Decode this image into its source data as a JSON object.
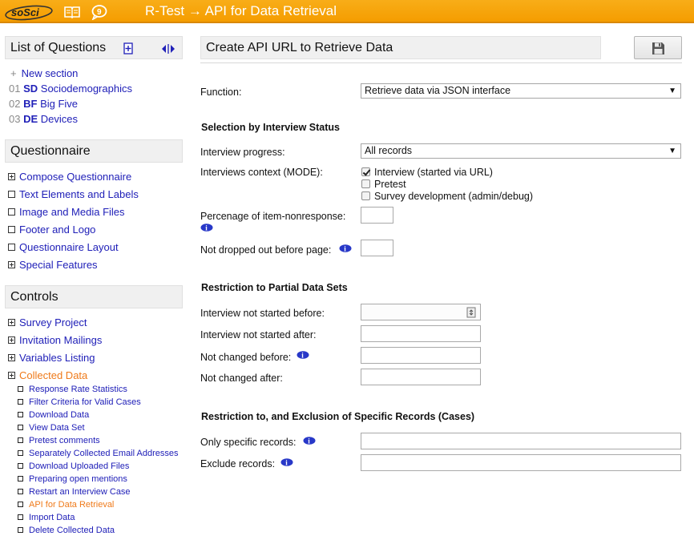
{
  "header": {
    "logo_text": "soSci",
    "title": "R-Test → API for Data Retrieval",
    "colors": {
      "bar": "#f59d00",
      "text": "#ffffff"
    },
    "icons": [
      "book-icon",
      "chat-icon"
    ]
  },
  "sidebar": {
    "questions": {
      "title": "List of Questions",
      "new_section": "New section",
      "items": [
        {
          "num": "01",
          "code": "SD",
          "name": "Sociodemographics"
        },
        {
          "num": "02",
          "code": "BF",
          "name": "Big Five"
        },
        {
          "num": "03",
          "code": "DE",
          "name": "Devices"
        }
      ]
    },
    "questionnaire": {
      "title": "Questionnaire",
      "items": [
        {
          "label": "Compose Questionnaire"
        },
        {
          "label": "Text Elements and Labels"
        },
        {
          "label": "Image and Media Files"
        },
        {
          "label": "Footer and Logo"
        },
        {
          "label": "Questionnaire Layout"
        },
        {
          "label": "Special Features"
        }
      ]
    },
    "controls": {
      "title": "Controls",
      "items": [
        {
          "label": "Survey Project"
        },
        {
          "label": "Invitation Mailings"
        },
        {
          "label": "Variables Listing"
        },
        {
          "label": "Collected Data"
        }
      ],
      "subitems": [
        {
          "label": "Response Rate Statistics"
        },
        {
          "label": "Filter Criteria for Valid Cases"
        },
        {
          "label": "Download Data"
        },
        {
          "label": "View Data Set"
        },
        {
          "label": "Pretest comments"
        },
        {
          "label": "Separately Collected Email Addresses"
        },
        {
          "label": "Download Uploaded Files"
        },
        {
          "label": "Preparing open mentions"
        },
        {
          "label": "Restart an Interview Case"
        },
        {
          "label": "API for Data Retrieval"
        },
        {
          "label": "Import Data"
        },
        {
          "label": "Delete Collected Data"
        }
      ]
    },
    "colors": {
      "link": "#2020b8",
      "active": "#ef7a1a"
    }
  },
  "main": {
    "title": "Create API URL to Retrieve Data",
    "function_label": "Function:",
    "function_value": "Retrieve data via JSON interface",
    "status_section": "Selection by Interview Status",
    "progress_label": "Interview progress:",
    "progress_value": "All records",
    "mode_label": "Interviews context (MODE):",
    "mode_options": [
      {
        "label": "Interview (started via URL)",
        "checked": true
      },
      {
        "label": "Pretest",
        "checked": false
      },
      {
        "label": "Survey development (admin/debug)",
        "checked": false
      }
    ],
    "nonresponse_label": "Percenage of item-nonresponse:",
    "nonresponse_value": "",
    "dropout_label": "Not dropped out before page:",
    "dropout_value": "",
    "partial_section": "Restriction to Partial Data Sets",
    "not_started_before_label": "Interview not started before:",
    "not_started_after_label": "Interview not started after:",
    "not_changed_before_label": "Not changed before:",
    "not_changed_after_label": "Not changed after:",
    "records_section": "Restriction to, and Exclusion of Specific Records (Cases)",
    "only_records_label": "Only specific records:",
    "exclude_records_label": "Exclude records:"
  }
}
